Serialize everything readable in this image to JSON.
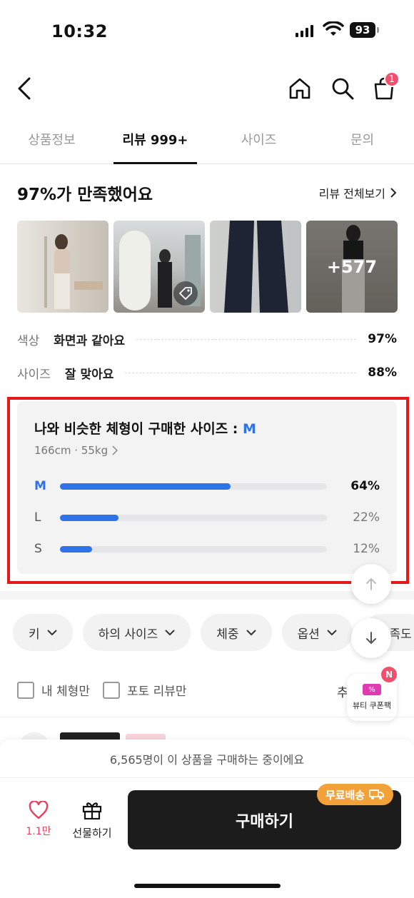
{
  "status_bar": {
    "time": "10:32",
    "battery": "93"
  },
  "header": {
    "cart_count": "1"
  },
  "tabs": [
    {
      "label": "상품정보",
      "active": false
    },
    {
      "label": "리뷰 999+",
      "active": true
    },
    {
      "label": "사이즈",
      "active": false
    },
    {
      "label": "문의",
      "active": false
    }
  ],
  "reviews": {
    "title": "97%가 만족했어요",
    "view_all": "리뷰 전체보기",
    "more_photos": "+577",
    "stats": [
      {
        "label": "색상",
        "value": "화면과 같아요",
        "percent": "97%"
      },
      {
        "label": "사이즈",
        "value": "잘 맞아요",
        "percent": "88%"
      }
    ]
  },
  "fit": {
    "title_prefix": "나와 비슷한 체형이 구매한 사이즈 : ",
    "title_size": "M",
    "body_info": "166cm · 55kg",
    "sizes": [
      {
        "label": "M",
        "percent_text": "64%",
        "value": 64,
        "top": true
      },
      {
        "label": "L",
        "percent_text": "22%",
        "value": 22,
        "top": false
      },
      {
        "label": "S",
        "percent_text": "12%",
        "value": 12,
        "top": false
      }
    ]
  },
  "filters": [
    "키",
    "하의 사이즈",
    "체중",
    "옵션",
    "만족도"
  ],
  "checkboxes": {
    "my_body": "내 체형만",
    "photo_only": "포토 리뷰만"
  },
  "sort_label": "추",
  "coupon": {
    "badge": "N",
    "label": "뷰티 쿠폰팩"
  },
  "purchase": {
    "buying_now": "6,565명이 이 상품을 구매하는 중이에요",
    "like_count": "1.1만",
    "gift_label": "선물하기",
    "buy_label": "구매하기",
    "free_shipping": "무료배송"
  },
  "colors": {
    "accent": "#2f73e8",
    "highlight": "#e41a1a",
    "badge": "#f0506e",
    "free_shipping": "#f3a23a"
  }
}
